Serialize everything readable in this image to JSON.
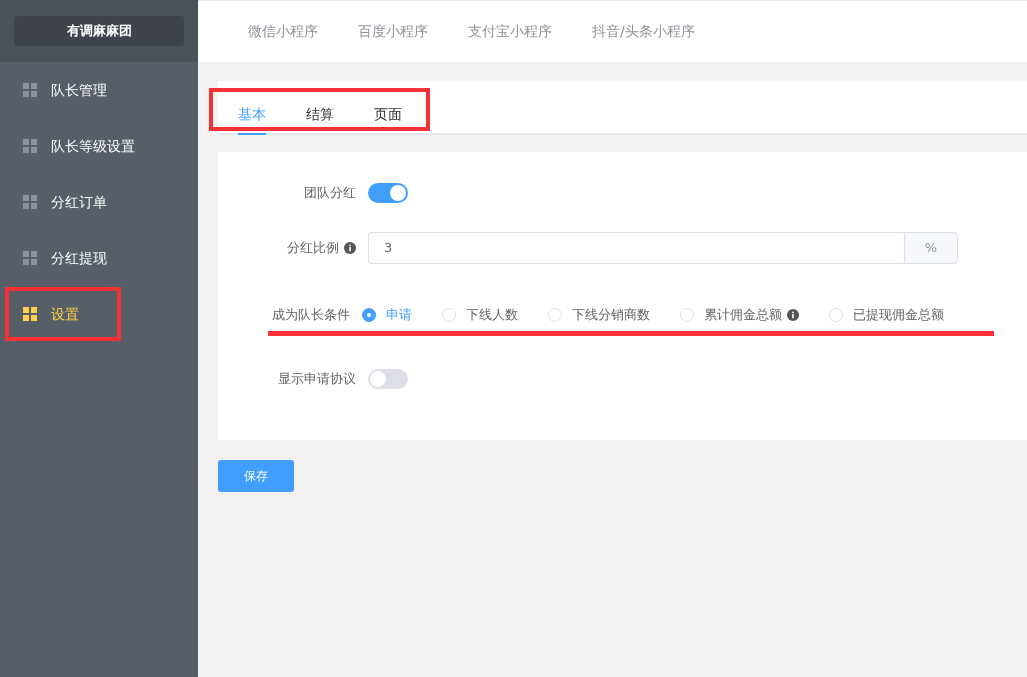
{
  "sidebar": {
    "logo": "有调麻麻团",
    "items": [
      {
        "label": "队长管理",
        "selected": false
      },
      {
        "label": "队长等级设置",
        "selected": false
      },
      {
        "label": "分红订单",
        "selected": false
      },
      {
        "label": "分红提现",
        "selected": false
      },
      {
        "label": "设置",
        "selected": true
      }
    ]
  },
  "platform_tabs": [
    "微信小程序",
    "百度小程序",
    "支付宝小程序",
    "抖音/头条小程序"
  ],
  "tabs": [
    {
      "label": "基本",
      "selected": true
    },
    {
      "label": "结算",
      "selected": false
    },
    {
      "label": "页面",
      "selected": false
    }
  ],
  "form": {
    "dividend": {
      "label": "团队分红",
      "on": true
    },
    "ratio": {
      "label": "分红比例",
      "info": true,
      "value": "3",
      "suffix": "%"
    },
    "condition": {
      "label": "成为队长条件",
      "options": [
        {
          "label": "申请",
          "selected": true,
          "info": false
        },
        {
          "label": "下线人数",
          "selected": false,
          "info": false
        },
        {
          "label": "下线分销商数",
          "selected": false,
          "info": false
        },
        {
          "label": "累计佣金总额",
          "selected": false,
          "info": true
        },
        {
          "label": "已提现佣金总额",
          "selected": false,
          "info": false
        }
      ]
    },
    "agreement": {
      "label": "显示申请协议",
      "on": false
    }
  },
  "save_button": "保存"
}
